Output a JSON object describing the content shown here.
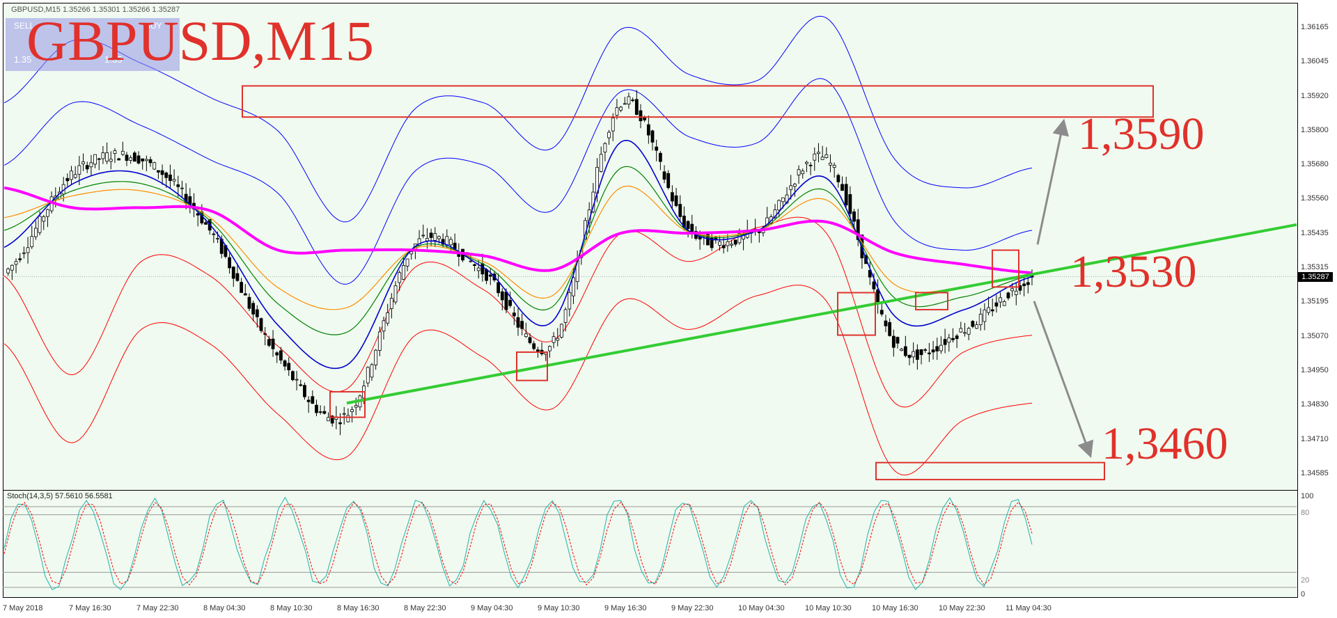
{
  "header": {
    "symbol_info": "GBPUSD,M15  1.35266 1.35301 1.35266 1.35287",
    "title": "GBPUSD,M15",
    "trade_panel": {
      "sell": "SELL",
      "buy": "BUY",
      "sell_price": "1.35 28",
      "buy_price": "1.35 31",
      "sell_small": "1.35",
      "buy_small": "1.35"
    }
  },
  "levels": {
    "upper": "1,3590",
    "middle": "1,3530",
    "lower": "1,3460"
  },
  "price_axis": {
    "ticks": [
      "1.36165",
      "1.36045",
      "1.35920",
      "1.35800",
      "1.35680",
      "1.35560",
      "1.35435",
      "1.35315",
      "1.35195",
      "1.35070",
      "1.34950",
      "1.34830",
      "1.34710",
      "1.34585"
    ],
    "current": "1.35287"
  },
  "time_axis": {
    "ticks": [
      "7 May 2018",
      "7 May 16:30",
      "7 May 22:30",
      "8 May 04:30",
      "8 May 10:30",
      "8 May 16:30",
      "8 May 22:30",
      "9 May 04:30",
      "9 May 10:30",
      "9 May 16:30",
      "9 May 22:30",
      "10 May 04:30",
      "10 May 10:30",
      "10 May 16:30",
      "10 May 22:30",
      "11 May 04:30"
    ]
  },
  "stochastic": {
    "label": "Stoch(14,3,5) 57.5610 56.5581",
    "ticks": [
      "100",
      "80",
      "20",
      "0"
    ]
  },
  "colors": {
    "background": "#F0FAF0",
    "sma_magenta": "#FF00FF",
    "ema_orange": "#FF8C00",
    "ema_green": "#008000",
    "ema_blue": "#0000CD",
    "bb_blue": "#0000FF",
    "bb_red": "#FF0000",
    "trendline": "#33CC33",
    "annotation_red": "#E0312B",
    "arrow_gray": "#8C8C8C",
    "stoch_main": "#20B2AA",
    "stoch_signal": "#FF0000"
  },
  "chart_data": {
    "type": "line",
    "title": "GBPUSD,M15",
    "x": [
      "7 May 2018",
      "7 May 16:30",
      "7 May 22:30",
      "8 May 04:30",
      "8 May 10:30",
      "8 May 16:30",
      "8 May 22:30",
      "9 May 04:30",
      "9 May 10:30",
      "9 May 16:30",
      "9 May 22:30",
      "10 May 04:30",
      "10 May 10:30",
      "10 May 16:30",
      "10 May 22:30",
      "11 May 04:30"
    ],
    "ylim": [
      1.3452,
      1.3622
    ],
    "series": [
      {
        "name": "Close",
        "values": [
          1.353,
          1.3565,
          1.357,
          1.3545,
          1.35,
          1.348,
          1.354,
          1.353,
          1.3505,
          1.359,
          1.3545,
          1.3545,
          1.357,
          1.3505,
          1.351,
          1.3528
        ]
      },
      {
        "name": "SMA (magenta)",
        "values": [
          1.356,
          1.3553,
          1.3553,
          1.3552,
          1.3538,
          1.3538,
          1.3538,
          1.3536,
          1.3531,
          1.3544,
          1.3544,
          1.3545,
          1.3548,
          1.3537,
          1.3533,
          1.353
        ]
      },
      {
        "name": "Upper Bollinger (blue)",
        "values": [
          1.359,
          1.3612,
          1.3604,
          1.3592,
          1.358,
          1.3548,
          1.3588,
          1.359,
          1.3574,
          1.3616,
          1.36,
          1.3598,
          1.362,
          1.357,
          1.356,
          1.3567
        ]
      },
      {
        "name": "Lower Bollinger (red)",
        "values": [
          1.3505,
          1.347,
          1.351,
          1.3505,
          1.348,
          1.3465,
          1.3508,
          1.35,
          1.3482,
          1.352,
          1.351,
          1.3522,
          1.352,
          1.346,
          1.3478,
          1.3484
        ]
      }
    ],
    "annotations": [
      {
        "label": "1,3590",
        "price": 1.359
      },
      {
        "label": "1,3530",
        "price": 1.353
      },
      {
        "label": "1,3460",
        "price": 1.346
      }
    ],
    "trendline": {
      "from": [
        "8 May 16:30",
        1.3484
      ],
      "to": [
        "11 May 10:00",
        1.3547
      ]
    },
    "stochastic": {
      "params": "14,3,5",
      "main": 57.561,
      "signal": 56.5581,
      "ylim": [
        0,
        100
      ],
      "levels": [
        20,
        80
      ]
    }
  }
}
